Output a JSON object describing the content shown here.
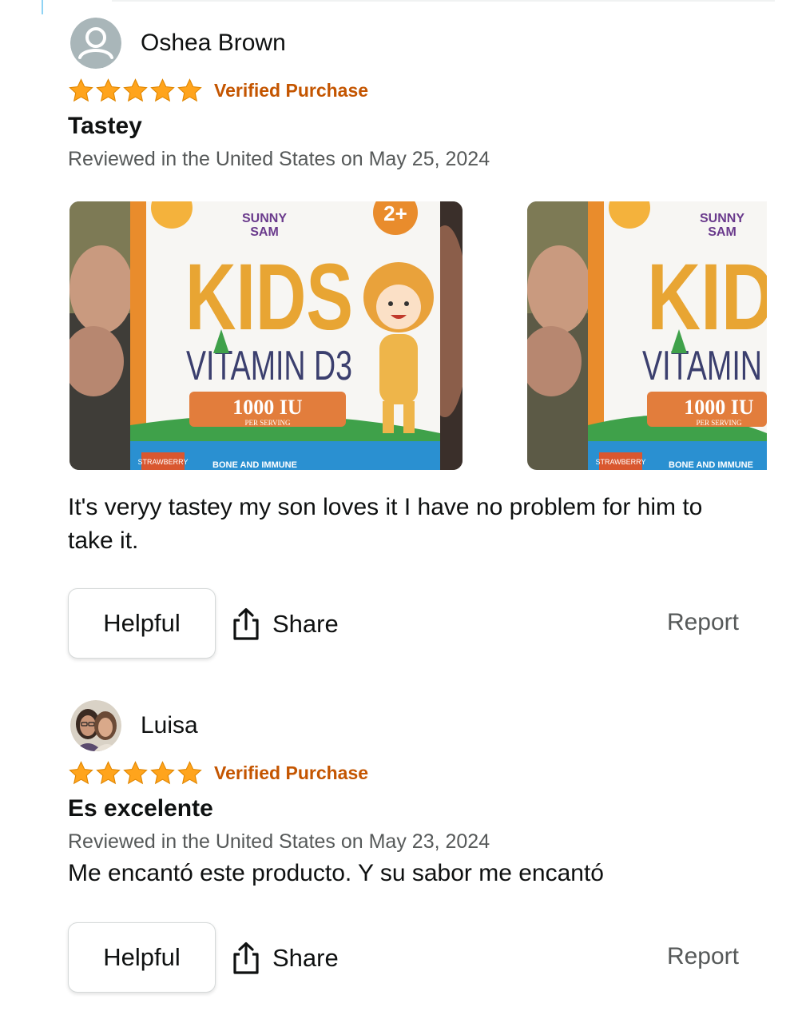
{
  "reviews": [
    {
      "reviewer": "Oshea Brown",
      "stars": 5,
      "verified": "Verified Purchase",
      "title": "Tastey",
      "meta": "Reviewed in the United States on May 25, 2024",
      "photo": {
        "brand_line1": "SUNNY",
        "brand_line2": "SAM",
        "product": "KIDS",
        "product_cropped": "KID",
        "subtitle": "VITAMIN D3",
        "subtitle_cropped": "VITAMIN",
        "dose": "1000 IU",
        "dose_sub": "PER SERVING",
        "age": "2+",
        "flavor": "STRAWBERRY",
        "bottom": "BONE AND IMMUNE"
      },
      "body": "It's veryy tastey my son loves it I have no problem for him to take it.",
      "helpful": "Helpful",
      "share": "Share",
      "report": "Report"
    },
    {
      "reviewer": "Luisa",
      "stars": 5,
      "verified": "Verified Purchase",
      "title": "Es excelente",
      "meta": "Reviewed in the United States on May 23, 2024",
      "body": "Me encantó este producto. Y su sabor me encantó",
      "helpful": "Helpful",
      "share": "Share",
      "report": "Report"
    }
  ],
  "colors": {
    "star": "#ffa41c",
    "verified": "#c45500",
    "muted": "#565959",
    "text": "#0f1111",
    "border": "#d5d9d9"
  }
}
